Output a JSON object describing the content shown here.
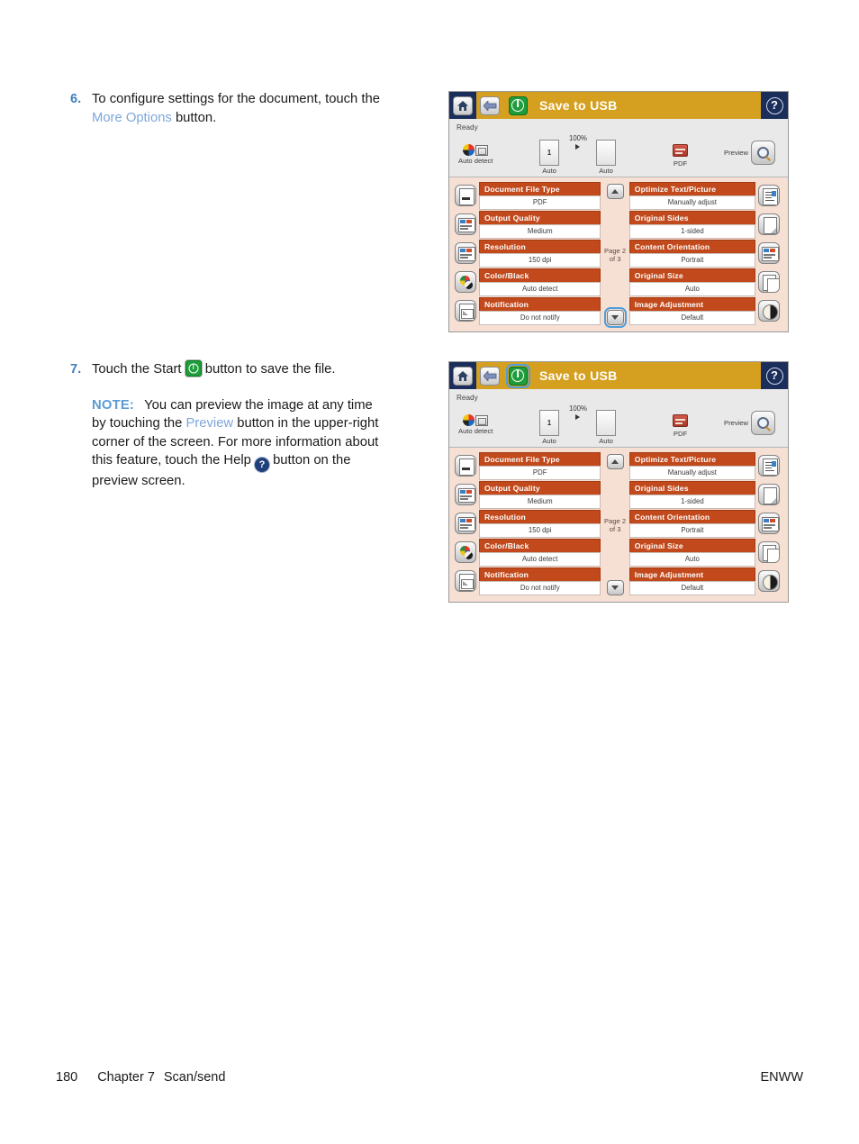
{
  "steps": [
    {
      "number": "6.",
      "text_before": "To configure settings for the document, touch the ",
      "link": "More Options",
      "text_after": " button."
    },
    {
      "number": "7.",
      "text_before": "Touch the Start ",
      "icon": "start-icon",
      "text_after": " button to save the file."
    }
  ],
  "note": {
    "label": "NOTE:",
    "part1": "You can preview the image at any time by touching the ",
    "link": "Preview",
    "part2": " button in the upper-right corner of the screen. For more information about this feature, touch the Help ",
    "part3": " button on the preview screen."
  },
  "screen": {
    "header": {
      "home_icon": "home-icon",
      "back_icon": "back-arrow-icon",
      "start_icon": "start-icon",
      "title": "Save to USB",
      "help_icon": "help-icon"
    },
    "status": "Ready",
    "toolbar": {
      "color_mode": "Auto detect",
      "zoom": "100%",
      "page_number": "1",
      "original_size": "Auto",
      "output_size": "Auto",
      "file_type": "PDF",
      "preview_label": "Preview"
    },
    "page_indicator_line1": "Page 2",
    "page_indicator_line2": "of 3",
    "left_settings": [
      {
        "title": "Document File Type",
        "value": "PDF",
        "icon": "document-file-type-icon"
      },
      {
        "title": "Output Quality",
        "value": "Medium",
        "icon": "output-quality-icon"
      },
      {
        "title": "Resolution",
        "value": "150 dpi",
        "icon": "resolution-icon"
      },
      {
        "title": "Color/Black",
        "value": "Auto detect",
        "icon": "color-black-icon"
      },
      {
        "title": "Notification",
        "value": "Do not notify",
        "icon": "notification-icon"
      }
    ],
    "right_settings": [
      {
        "title": "Optimize Text/Picture",
        "value": "Manually adjust",
        "icon": "optimize-text-picture-icon"
      },
      {
        "title": "Original Sides",
        "value": "1-sided",
        "icon": "original-sides-icon"
      },
      {
        "title": "Content Orientation",
        "value": "Portrait",
        "icon": "content-orientation-icon"
      },
      {
        "title": "Original Size",
        "value": "Auto",
        "icon": "original-size-icon"
      },
      {
        "title": "Image Adjustment",
        "value": "Default",
        "icon": "image-adjustment-icon"
      }
    ]
  },
  "footer": {
    "page_number": "180",
    "chapter": "Chapter 7",
    "section": "Scan/send",
    "locale": "ENWW"
  },
  "colors": {
    "header_bar": "#d5a020",
    "setting_header": "#c1491b",
    "panel_bg": "#f6dfd3",
    "link": "#7da7d9",
    "step_number": "#3f7fbf",
    "note_label": "#5b9bd5",
    "navy": "#1b2d5b",
    "start_green": "#1f9d3b",
    "highlight": "#4d9ede"
  }
}
